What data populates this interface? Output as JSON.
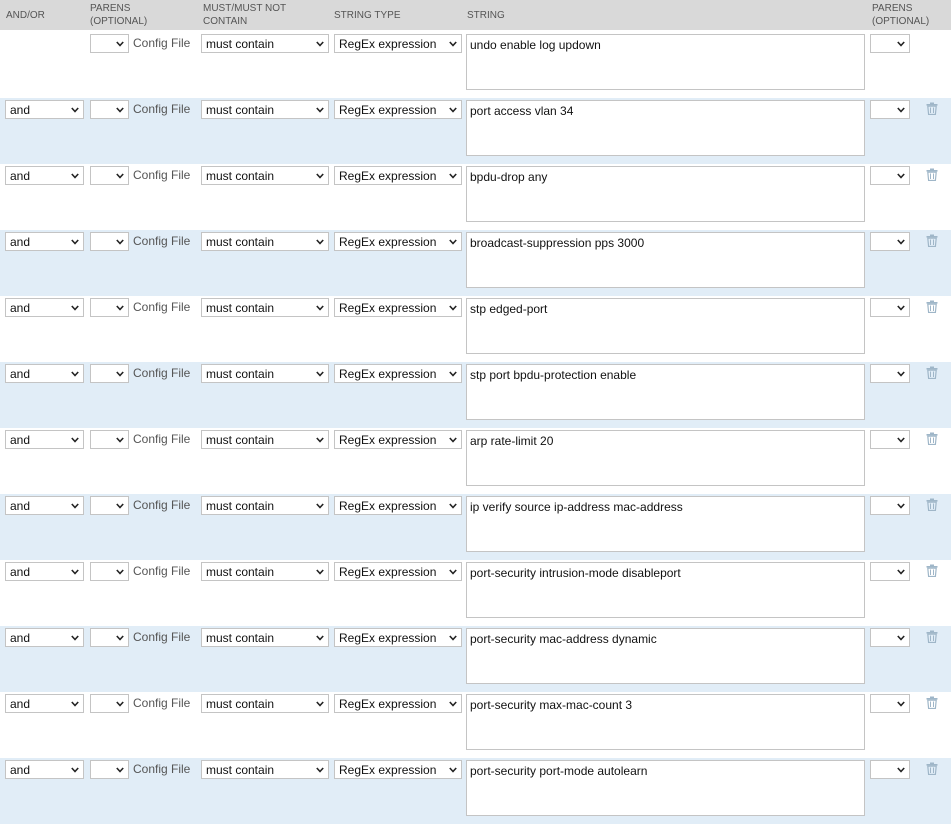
{
  "header": {
    "and_or": "AND/OR",
    "parens_open_1": "PARENS",
    "parens_open_2": "(OPTIONAL)",
    "must_1": "MUST/MUST NOT",
    "must_2": "CONTAIN",
    "string_type": "STRING TYPE",
    "string": "STRING",
    "parens_close_1": "PARENS",
    "parens_close_2": "(OPTIONAL)"
  },
  "icons": {
    "dropdown": "chevron-down-icon",
    "delete": "trash-icon"
  },
  "colors": {
    "header_bg": "#d9d9d9",
    "alt_row_bg": "#e1edf7",
    "icon": "#9fb6c8"
  },
  "rows": [
    {
      "and_or": "",
      "paren_open": "",
      "source": "Config File",
      "condition": "must contain",
      "string_type": "RegEx expression",
      "string": "undo enable log updown",
      "paren_close": "",
      "deletable": false
    },
    {
      "and_or": "and",
      "paren_open": "",
      "source": "Config File",
      "condition": "must contain",
      "string_type": "RegEx expression",
      "string": "port access vlan 34",
      "paren_close": "",
      "deletable": true
    },
    {
      "and_or": "and",
      "paren_open": "",
      "source": "Config File",
      "condition": "must contain",
      "string_type": "RegEx expression",
      "string": "bpdu-drop any",
      "paren_close": "",
      "deletable": true
    },
    {
      "and_or": "and",
      "paren_open": "",
      "source": "Config File",
      "condition": "must contain",
      "string_type": "RegEx expression",
      "string": "broadcast-suppression pps 3000",
      "paren_close": "",
      "deletable": true
    },
    {
      "and_or": "and",
      "paren_open": "",
      "source": "Config File",
      "condition": "must contain",
      "string_type": "RegEx expression",
      "string": "stp edged-port",
      "paren_close": "",
      "deletable": true
    },
    {
      "and_or": "and",
      "paren_open": "",
      "source": "Config File",
      "condition": "must contain",
      "string_type": "RegEx expression",
      "string": "stp port bpdu-protection enable",
      "paren_close": "",
      "deletable": true
    },
    {
      "and_or": "and",
      "paren_open": "",
      "source": "Config File",
      "condition": "must contain",
      "string_type": "RegEx expression",
      "string": "arp rate-limit 20",
      "paren_close": "",
      "deletable": true
    },
    {
      "and_or": "and",
      "paren_open": "",
      "source": "Config File",
      "condition": "must contain",
      "string_type": "RegEx expression",
      "string": "ip verify source ip-address mac-address",
      "paren_close": "",
      "deletable": true
    },
    {
      "and_or": "and",
      "paren_open": "",
      "source": "Config File",
      "condition": "must contain",
      "string_type": "RegEx expression",
      "string": "port-security intrusion-mode disableport",
      "paren_close": "",
      "deletable": true
    },
    {
      "and_or": "and",
      "paren_open": "",
      "source": "Config File",
      "condition": "must contain",
      "string_type": "RegEx expression",
      "string": "port-security mac-address dynamic",
      "paren_close": "",
      "deletable": true
    },
    {
      "and_or": "and",
      "paren_open": "",
      "source": "Config File",
      "condition": "must contain",
      "string_type": "RegEx expression",
      "string": "port-security max-mac-count 3",
      "paren_close": "",
      "deletable": true
    },
    {
      "and_or": "and",
      "paren_open": "",
      "source": "Config File",
      "condition": "must contain",
      "string_type": "RegEx expression",
      "string": "port-security port-mode autolearn",
      "paren_close": "",
      "deletable": true
    }
  ]
}
